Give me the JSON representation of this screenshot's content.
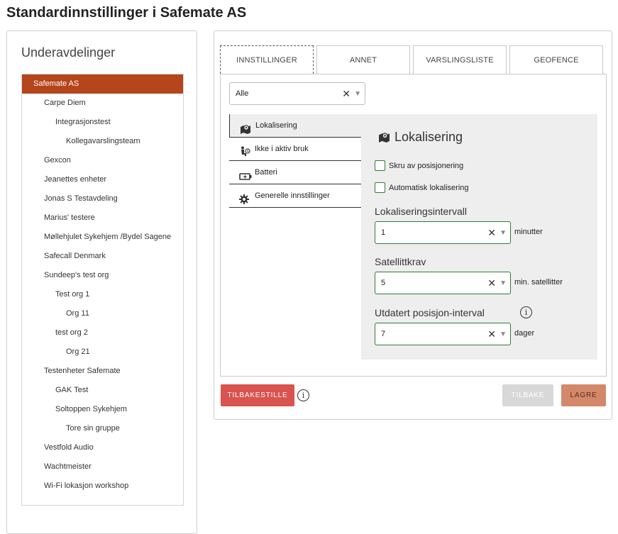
{
  "page_title": "Standardinnstillinger i Safemate AS",
  "sidebar": {
    "title": "Underavdelinger",
    "items": [
      {
        "label": "Safemate AS",
        "level": 0,
        "selected": true
      },
      {
        "label": "Carpe Diem",
        "level": 1
      },
      {
        "label": "Integrasjonstest",
        "level": 2
      },
      {
        "label": "Kollegavarslingsteam",
        "level": 3
      },
      {
        "label": "Gexcon",
        "level": 1
      },
      {
        "label": "Jeanettes enheter",
        "level": 1
      },
      {
        "label": "Jonas S Testavdeling",
        "level": 1
      },
      {
        "label": "Marius' testere",
        "level": 1
      },
      {
        "label": "Møllehjulet Sykehjem /Bydel Sagene",
        "level": 1
      },
      {
        "label": "Safecall Denmark",
        "level": 1
      },
      {
        "label": "Sundeep's test org",
        "level": 1
      },
      {
        "label": "Test org 1",
        "level": 2
      },
      {
        "label": "Org 11",
        "level": 3
      },
      {
        "label": "test org 2",
        "level": 2
      },
      {
        "label": "Org 21",
        "level": 3
      },
      {
        "label": "Testenheter Safemate",
        "level": 1
      },
      {
        "label": "GAK Test",
        "level": 2
      },
      {
        "label": "Soltoppen Sykehjem",
        "level": 2
      },
      {
        "label": "Tore sin gruppe",
        "level": 3
      },
      {
        "label": "Vestfold Audio",
        "level": 1
      },
      {
        "label": "Wachtmeister",
        "level": 1
      },
      {
        "label": "Wi-Fi lokasjon workshop",
        "level": 1
      }
    ]
  },
  "tabs": [
    {
      "label": "INNSTILLINGER",
      "active": true
    },
    {
      "label": "ANNET"
    },
    {
      "label": "VARSLINGSLISTE"
    },
    {
      "label": "GEOFENCE"
    }
  ],
  "filter": {
    "value": "Alle",
    "clear": "✕",
    "caret": "▼"
  },
  "menu": {
    "items": [
      {
        "label": "Lokalisering",
        "icon": "map-marker-icon",
        "active": true
      },
      {
        "label": "Ikke i aktiv bruk",
        "icon": "inactive-person-icon"
      },
      {
        "label": "Batteri",
        "icon": "battery-icon"
      },
      {
        "label": "Generelle innstillinger",
        "icon": "gear-icon"
      }
    ]
  },
  "section": {
    "heading": "Lokalisering",
    "checkboxes": [
      {
        "label": "Skru av posisjonering",
        "checked": false
      },
      {
        "label": "Automatisk lokalisering",
        "checked": false
      }
    ],
    "fields": [
      {
        "label": "Lokaliseringsintervall",
        "value": "1",
        "unit": "minutter"
      },
      {
        "label": "Satellittkrav",
        "value": "5",
        "unit": "min. satellitter"
      },
      {
        "label": "Utdatert posisjon-interval",
        "value": "7",
        "unit": "dager",
        "info": "i"
      }
    ]
  },
  "actions": {
    "reset_label": "TILBAKESTILLE",
    "reset_info": "i",
    "back_label": "TILBAKE",
    "save_label": "LAGRE"
  },
  "colors": {
    "selected_row": "#b5451b",
    "reset_button": "#d9534f",
    "save_button": "#d3886a",
    "field_border": "#2e7d32"
  }
}
